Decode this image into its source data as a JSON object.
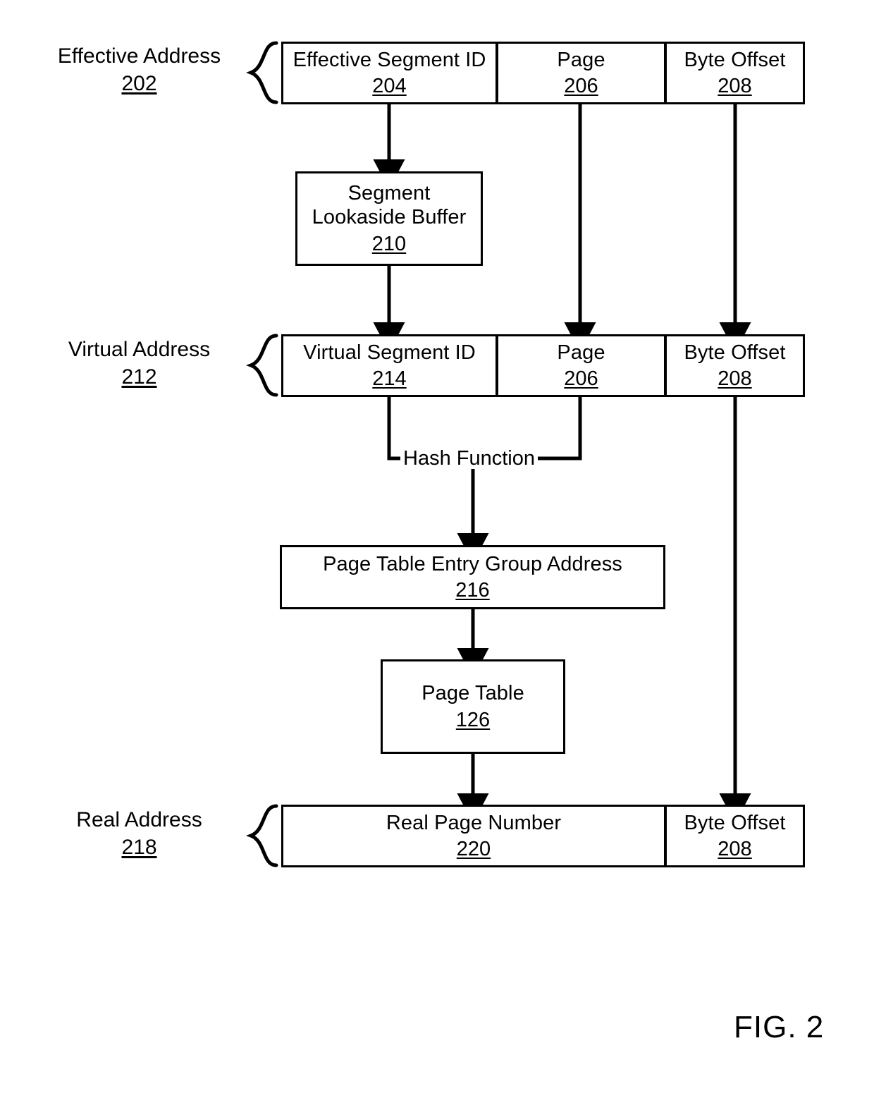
{
  "figure": {
    "caption": "FIG. 2"
  },
  "side_labels": [
    {
      "name": "effective-address",
      "text": "Effective Address",
      "ref": "202"
    },
    {
      "name": "virtual-address",
      "text": "Virtual Address",
      "ref": "212"
    },
    {
      "name": "real-address",
      "text": "Real Address",
      "ref": "218"
    }
  ],
  "rows": {
    "effective_address": {
      "cells": [
        {
          "name": "effective-segment-id",
          "title": "Effective Segment ID",
          "ref": "204"
        },
        {
          "name": "page",
          "title": "Page",
          "ref": "206"
        },
        {
          "name": "byte-offset",
          "title": "Byte Offset",
          "ref": "208"
        }
      ]
    },
    "virtual_address": {
      "cells": [
        {
          "name": "virtual-segment-id",
          "title": "Virtual Segment ID",
          "ref": "214"
        },
        {
          "name": "page",
          "title": "Page",
          "ref": "206"
        },
        {
          "name": "byte-offset",
          "title": "Byte Offset",
          "ref": "208"
        }
      ]
    },
    "real_address": {
      "cells": [
        {
          "name": "real-page-number",
          "title": "Real Page Number",
          "ref": "220"
        },
        {
          "name": "byte-offset",
          "title": "Byte Offset",
          "ref": "208"
        }
      ]
    }
  },
  "nodes": {
    "segment_lookaside_buffer": {
      "line1": "Segment",
      "line2": "Lookaside Buffer",
      "ref": "210"
    },
    "page_table_entry_group_address": {
      "title": "Page Table Entry Group Address",
      "ref": "216"
    },
    "page_table": {
      "title": "Page Table",
      "ref": "126"
    }
  },
  "edges": {
    "hash_function": "Hash Function"
  },
  "colors": {
    "stroke": "#000000",
    "background": "#ffffff"
  }
}
